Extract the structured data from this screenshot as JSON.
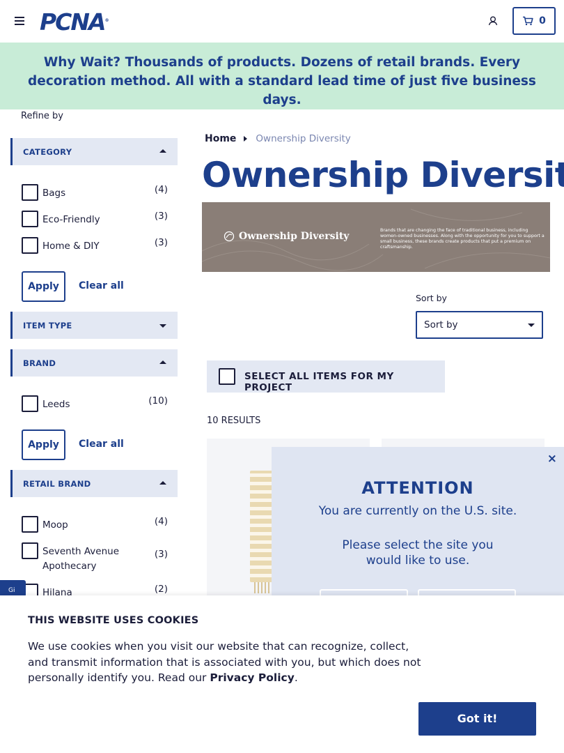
{
  "header": {
    "logo_text": "PCNA",
    "logo_mark": "®",
    "cart_count": "0"
  },
  "banner": {
    "lead": "Why Wait?",
    "text": " Thousands of products. Dozens of retail brands. Every decoration method. All with a standard lead time of just five business days."
  },
  "sidebar": {
    "refine_label": "Refine by",
    "category": {
      "title": "CATEGORY",
      "options": [
        {
          "label": "Bags",
          "count": "(4)"
        },
        {
          "label": "Eco-Friendly",
          "count": "(3)"
        },
        {
          "label": "Home & DIY",
          "count": "(3)"
        }
      ],
      "apply": "Apply",
      "clear": "Clear all"
    },
    "item_type": {
      "title": "ITEM TYPE"
    },
    "brand": {
      "title": "BRAND",
      "options": [
        {
          "label": "Leeds",
          "count": "(10)"
        }
      ],
      "apply": "Apply",
      "clear": "Clear all"
    },
    "retail_brand": {
      "title": "RETAIL BRAND",
      "options": [
        {
          "label": "Moop",
          "count": "(4)"
        },
        {
          "label": "Seventh Avenue Apothecary",
          "count": "(3)"
        },
        {
          "label": "Hilana",
          "count": "(2)"
        }
      ]
    }
  },
  "main": {
    "breadcrumb": {
      "home": "Home",
      "current": "Ownership Diversity"
    },
    "title": "Ownership Diversity",
    "hero": {
      "title": "Ownership Diversity",
      "description": "Brands that are changing the face of traditional business, including women-owned businesses. Along with the opportunity for you to support a small business, these brands create products that put a premium on craftsmanship."
    },
    "sort": {
      "label": "Sort by",
      "selected": "Sort by"
    },
    "select_all": "SELECT ALL ITEMS FOR MY PROJECT",
    "results": "10 RESULTS"
  },
  "modal": {
    "title": "ATTENTION",
    "line1": "You are currently on the U.S. site.",
    "line2": "Please select the site you",
    "line3": "would like to use.",
    "close": "×"
  },
  "feedback_tab": "Gi",
  "cookie": {
    "title": "THIS WEBSITE USES COOKIES",
    "text": "We use cookies when you visit our website that can recognize, collect, and transmit information that is associated with you, but which does not personally identify you. Read our ",
    "link": "Privacy Policy",
    "end": ".",
    "button": "Got it!"
  },
  "colors": {
    "brand": "#1d3f8c",
    "banner_bg": "#c8ecd7",
    "facet_bg": "#e3e8f3"
  }
}
